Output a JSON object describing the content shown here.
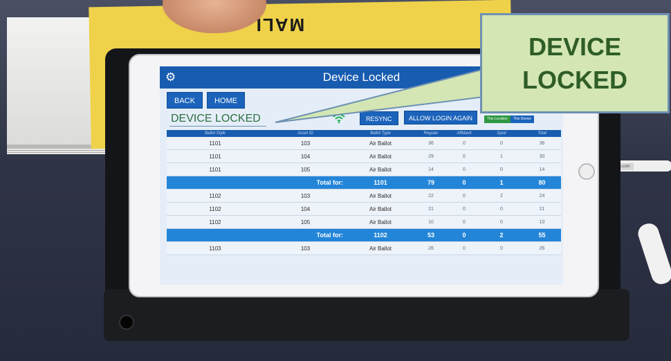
{
  "scene": {
    "paper_banner": "MALL",
    "cable_brand": "StarTech.com"
  },
  "app": {
    "title": "Device Locked",
    "settings_icon": "gear-icon"
  },
  "nav": {
    "back_label": "BACK",
    "home_label": "HOME"
  },
  "status": {
    "locked_label": "DEVICE LOCKED",
    "wifi_icon": "wifi-icon",
    "resync_label": "RESYNC",
    "allow_login_label": "ALLOW LOGIN AGAIN",
    "toggle_this_location": "This Location",
    "toggle_this_device": "This Device"
  },
  "table": {
    "headers": [
      "Ballot Style",
      "Asset ID",
      "Ballot Type",
      "Regular",
      "Affidavit",
      "Spoil",
      "Total"
    ],
    "rows": [
      {
        "style": "1101",
        "asset": "103",
        "type": "Air Ballot",
        "regular": "36",
        "affidavit": "0",
        "spoil": "0",
        "total": "36"
      },
      {
        "style": "1101",
        "asset": "104",
        "type": "Air Ballot",
        "regular": "29",
        "affidavit": "0",
        "spoil": "1",
        "total": "30"
      },
      {
        "style": "1101",
        "asset": "105",
        "type": "Air Ballot",
        "regular": "14",
        "affidavit": "0",
        "spoil": "0",
        "total": "14"
      },
      {
        "total_label": "Total for:",
        "style": "1101",
        "regular": "79",
        "affidavit": "0",
        "spoil": "1",
        "total": "80"
      },
      {
        "style": "1102",
        "asset": "103",
        "type": "Air Ballot",
        "regular": "22",
        "affidavit": "0",
        "spoil": "2",
        "total": "24"
      },
      {
        "style": "1102",
        "asset": "104",
        "type": "Air Ballot",
        "regular": "21",
        "affidavit": "0",
        "spoil": "0",
        "total": "21"
      },
      {
        "style": "1102",
        "asset": "105",
        "type": "Air Ballot",
        "regular": "10",
        "affidavit": "0",
        "spoil": "0",
        "total": "10"
      },
      {
        "total_label": "Total for:",
        "style": "1102",
        "regular": "53",
        "affidavit": "0",
        "spoil": "2",
        "total": "55"
      },
      {
        "style": "1103",
        "asset": "103",
        "type": "Air Ballot",
        "regular": "26",
        "affidavit": "0",
        "spoil": "0",
        "total": "26"
      }
    ]
  },
  "callout": {
    "line1": "DEVICE",
    "line2": "LOCKED"
  },
  "colors": {
    "header_blue": "#185cb0",
    "total_row_blue": "#2385d8",
    "locked_green": "#2b6f3f",
    "callout_fill": "#d3e6b3",
    "callout_text": "#2f5d28"
  }
}
